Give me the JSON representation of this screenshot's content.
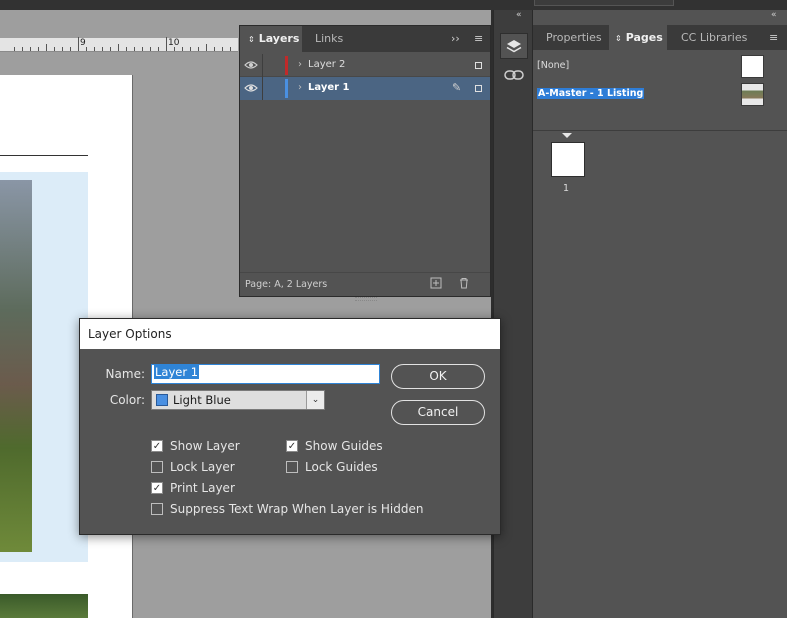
{
  "layers_panel": {
    "tabs": [
      {
        "label": "Layers",
        "active": true
      },
      {
        "label": "Links",
        "active": false
      }
    ],
    "layers": [
      {
        "name": "Layer 2",
        "color": "#c02a2a",
        "visible": true,
        "selected": false
      },
      {
        "name": "Layer 1",
        "color": "#4a90e2",
        "visible": true,
        "selected": true
      }
    ],
    "status": "Page: A, 2 Layers"
  },
  "pages_panel": {
    "tabs": [
      {
        "label": "Properties",
        "active": false
      },
      {
        "label": "Pages",
        "active": true
      },
      {
        "label": "CC Libraries",
        "active": false
      }
    ],
    "masters": [
      {
        "name": "[None]",
        "selected": false
      },
      {
        "name": "A-Master - 1 Listing",
        "selected": true
      }
    ],
    "page_number": "1"
  },
  "ruler": {
    "labels": [
      "9",
      "10"
    ]
  },
  "dialog": {
    "title": "Layer Options",
    "name_label": "Name:",
    "name_value": "Layer 1",
    "color_label": "Color:",
    "color_value": "Light Blue",
    "color_swatch": "#4a90e2",
    "ok_label": "OK",
    "cancel_label": "Cancel",
    "options": {
      "show_layer": {
        "label": "Show Layer",
        "checked": true
      },
      "lock_layer": {
        "label": "Lock Layer",
        "checked": false
      },
      "print_layer": {
        "label": "Print Layer",
        "checked": true
      },
      "suppress_wrap": {
        "label": "Suppress Text Wrap When Layer is Hidden",
        "checked": false
      },
      "show_guides": {
        "label": "Show Guides",
        "checked": true
      },
      "lock_guides": {
        "label": "Lock Guides",
        "checked": false
      }
    }
  },
  "icons": {
    "eye": "eye-icon",
    "pencil": "pencil-icon",
    "new_layer": "new-layer-icon",
    "trash": "trash-icon",
    "layers": "layers-icon",
    "links": "links-icon",
    "menu": "panel-menu-icon",
    "expand": "expand-icon",
    "collapse": "collapse-icon"
  }
}
